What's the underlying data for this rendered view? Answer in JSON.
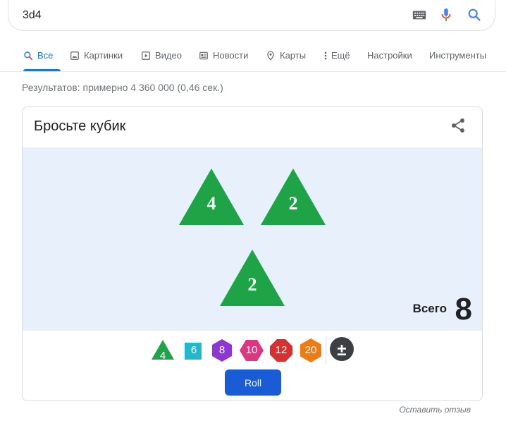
{
  "search": {
    "query": "3d4"
  },
  "tabs": [
    {
      "label": "Все",
      "active": true
    },
    {
      "label": "Картинки"
    },
    {
      "label": "Видео"
    },
    {
      "label": "Новости"
    },
    {
      "label": "Карты"
    },
    {
      "label": "Ещё"
    },
    {
      "label": "Настройки"
    },
    {
      "label": "Инструменты"
    }
  ],
  "result_stats": "Результатов: примерно 4 360 000 (0,46 сек.)",
  "card": {
    "title": "Бросьте кубик",
    "dice_results": [
      "4",
      "2",
      "2"
    ],
    "total_label": "Всего",
    "total_value": "8",
    "die_options": [
      "4",
      "6",
      "8",
      "10",
      "12",
      "20"
    ],
    "modifier_symbol": "±",
    "roll_label": "Roll"
  },
  "feedback_link": "Оставить отзыв",
  "colors": {
    "accent": "#1a73e8",
    "d4": "#1ea446",
    "d6": "#1fb8cc",
    "d8": "#8e35d6",
    "d10": "#e0357f",
    "d12": "#d8302f",
    "d20": "#ef7b12",
    "modifier": "#3c4043",
    "dice_area_bg": "#e8f0fb",
    "roll_button": "#1a5bd6"
  }
}
